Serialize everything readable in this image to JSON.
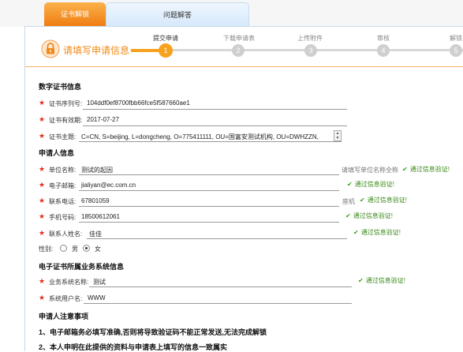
{
  "tabs": {
    "active": "证书解锁",
    "inactive": "问题解答"
  },
  "header": {
    "title": "请填写申请信息"
  },
  "steps": [
    {
      "label": "提交申请",
      "num": "1"
    },
    {
      "label": "下载申请表",
      "num": "2"
    },
    {
      "label": "上传附件",
      "num": "3"
    },
    {
      "label": "审核",
      "num": "4"
    },
    {
      "label": "解锁",
      "num": "5"
    }
  ],
  "sections": {
    "cert": "数字证书信息",
    "applicant": "申请人信息",
    "business": "电子证书所属业务系统信息",
    "notes": "申请人注意事项"
  },
  "cert": {
    "serial_label": "证书序列号:",
    "serial_value": "104ddf0ef8700fbb66fce5f587660ae1",
    "validity_label": "证书有效期:",
    "validity_value": "2017-07-27",
    "subject_label": "证书主题:",
    "subject_value": "C=CN, S=beijing, L=dongcheng, O=775411111, OU=国富安测试机构, OU=DWHZZN,"
  },
  "applicant": {
    "unit_label": "单位名称:",
    "unit_value": "测试的起因",
    "unit_hint": "请填写单位名称全称",
    "unit_ok": "通过信息验证!",
    "email_label": "电子邮箱:",
    "email_value": "jialiyan@ec.com.cn",
    "email_ok": "通过信息验证!",
    "phone_label": "联系电话:",
    "phone_value": "67801059",
    "phone_hint": "座机",
    "phone_ok": "通过信息验证!",
    "mobile_label": "手机号码:",
    "mobile_value": "18500612061",
    "mobile_ok": "通过信息验证!",
    "contact_label": "联系人姓名:",
    "contact_value": "佳佳",
    "contact_ok": "通过信息验证!",
    "gender_label": "性别:",
    "gender_male": "男",
    "gender_female": "女",
    "gender_selected": "女"
  },
  "business": {
    "name_label": "业务系统名称:",
    "name_value": "测试",
    "name_ok": "通过信息验证!",
    "user_label": "系统用户名:",
    "user_value": "WWW"
  },
  "notes": [
    "1、电子邮箱务必填写准确,否则将导致验证码不能正常发送,无法完成解锁",
    "2、本人申明在此提供的资料与申请表上填写的信息一致属实"
  ]
}
